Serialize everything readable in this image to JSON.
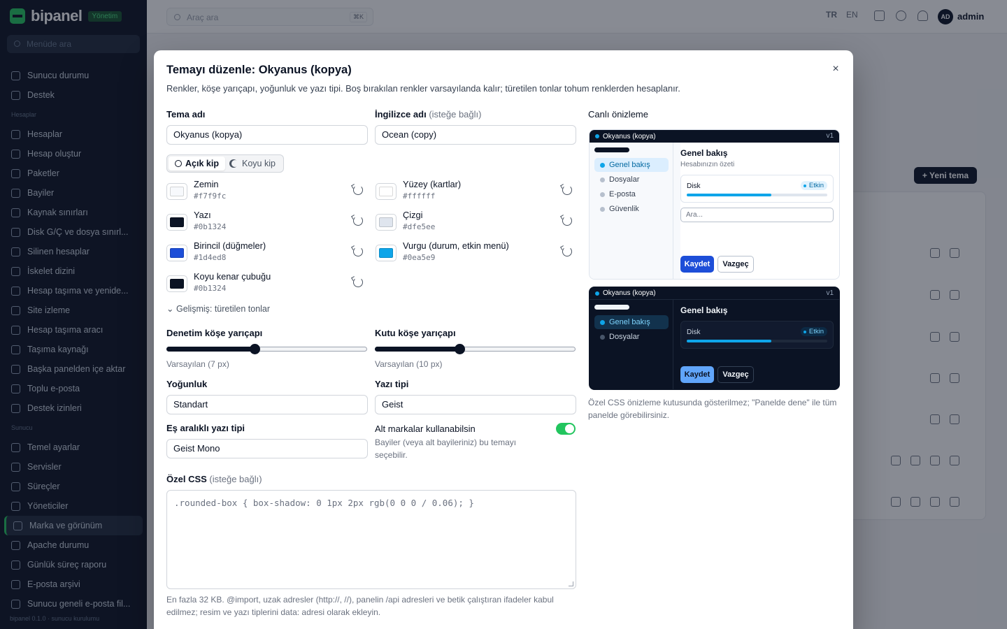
{
  "app": {
    "brand": "bipanel",
    "badge": "Yönetim",
    "footer": "bipanel 0.1.0 · sunucu kurulumu"
  },
  "sidebar": {
    "search_placeholder": "Menüde ara",
    "items": [
      {
        "label": "Sunucu durumu"
      },
      {
        "label": "Destek"
      },
      {
        "section": "Hesaplar"
      },
      {
        "label": "Hesaplar"
      },
      {
        "label": "Hesap oluştur"
      },
      {
        "label": "Paketler"
      },
      {
        "label": "Bayiler"
      },
      {
        "label": "Kaynak sınırları"
      },
      {
        "label": "Disk G/Ç ve dosya sınırl..."
      },
      {
        "label": "Silinen hesaplar"
      },
      {
        "label": "İskelet dizini"
      },
      {
        "label": "Hesap taşıma ve yenide..."
      },
      {
        "label": "Site izleme"
      },
      {
        "label": "Hesap taşıma aracı"
      },
      {
        "label": "Taşıma kaynağı"
      },
      {
        "label": "Başka panelden içe aktar"
      },
      {
        "label": "Toplu e-posta"
      },
      {
        "label": "Destek izinleri"
      },
      {
        "section": "Sunucu"
      },
      {
        "label": "Temel ayarlar"
      },
      {
        "label": "Servisler"
      },
      {
        "label": "Süreçler"
      },
      {
        "label": "Yöneticiler"
      },
      {
        "label": "Marka ve görünüm",
        "active": true
      },
      {
        "label": "Apache durumu"
      },
      {
        "label": "Günlük süreç raporu"
      },
      {
        "label": "E-posta arşivi"
      },
      {
        "label": "Sunucu geneli e-posta fil..."
      }
    ]
  },
  "topbar": {
    "search_placeholder": "Araç ara",
    "shortcut": "⌘K",
    "lang_tr": "TR",
    "lang_en": "EN",
    "user_initials": "AD",
    "user_name": "admin"
  },
  "page": {
    "new_theme_label": "+ Yeni tema"
  },
  "modal": {
    "title": "Temayı düzenle: Okyanus (kopya)",
    "description": "Renkler, köşe yarıçapı, yoğunluk ve yazı tipi. Boş bırakılan renkler varsayılanda kalır; türetilen tonlar tohum renklerden hesaplanır.",
    "close": "×",
    "theme_name_label": "Tema adı",
    "theme_name_value": "Okyanus (kopya)",
    "en_name_label": "İngilizce adı",
    "en_name_optional": "(isteğe bağlı)",
    "en_name_value": "Ocean (copy)",
    "mode_light": "Açık kip",
    "mode_dark": "Koyu kip",
    "colors": [
      {
        "name": "Zemin",
        "hex": "#f7f9fc",
        "color": "#f7f9fc"
      },
      {
        "name": "Yüzey (kartlar)",
        "hex": "#ffffff",
        "color": "#ffffff"
      },
      {
        "name": "Yazı",
        "hex": "#0b1324",
        "color": "#0b1324"
      },
      {
        "name": "Çizgi",
        "hex": "#dfe5ee",
        "color": "#dfe5ee"
      },
      {
        "name": "Birincil (düğmeler)",
        "hex": "#1d4ed8",
        "color": "#1d4ed8"
      },
      {
        "name": "Vurgu (durum, etkin menü)",
        "hex": "#0ea5e9",
        "color": "#0ea5e9"
      },
      {
        "name": "Koyu kenar çubuğu",
        "hex": "#0b1324",
        "color": "#0b1324"
      }
    ],
    "advanced_label": "Gelişmiş: türetilen tonlar",
    "control_radius_label": "Denetim köşe yarıçapı",
    "control_radius_hint": "Varsayılan (7 px)",
    "control_radius_value": 0.44,
    "box_radius_label": "Kutu köşe yarıçapı",
    "box_radius_hint": "Varsayılan (10 px)",
    "box_radius_value": 0.42,
    "density_label": "Yoğunluk",
    "density_value": "Standart",
    "font_label": "Yazı tipi",
    "font_value": "Geist",
    "mono_font_label": "Eş aralıklı yazı tipi",
    "mono_font_value": "Geist Mono",
    "sub_brands_label": "Alt markalar kullanabilsin",
    "sub_brands_hint": "Bayiler (veya alt bayileriniz) bu temayı seçebilir.",
    "sub_brands_enabled": true,
    "css_label": "Özel CSS",
    "css_optional": "(isteğe bağlı)",
    "css_placeholder": ".rounded-box { box-shadow: 0 1px 2px rgb(0 0 0 / 0.06); }",
    "css_note": "En fazla 32 KB. @import, uzak adresler (http://, //), panelin /api adresleri ve betik çalıştıran ifadeler kabul edilmez; resim ve yazı tiplerini data: adresi olarak ekleyin."
  },
  "preview": {
    "label": "Canlı önizleme",
    "theme_name": "Okyanus (kopya)",
    "version": "v1",
    "light_nav": [
      "Genel bakış",
      "Dosyalar",
      "E-posta",
      "Güvenlik"
    ],
    "dark_nav": [
      "Genel bakış",
      "Dosyalar"
    ],
    "heading": "Genel bakış",
    "subheading": "Hesabınızın özeti",
    "disk_label": "Disk",
    "badge": "Etkin",
    "disk_usage": 0.6,
    "search_placeholder": "Ara...",
    "save": "Kaydet",
    "cancel": "Vazgeç",
    "note": "Özel CSS önizleme kutusunda gösterilmez; \"Panelde dene\" ile tüm panelde görebilirsiniz."
  }
}
